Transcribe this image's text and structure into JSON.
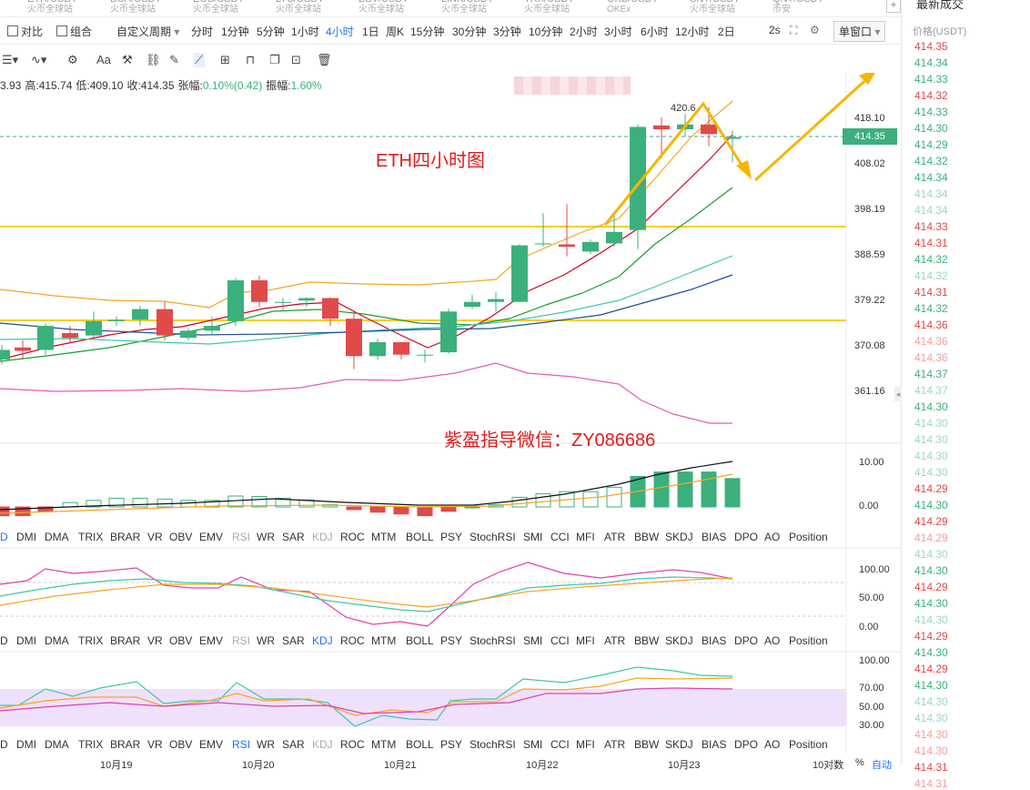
{
  "pairs": [
    {
      "name": "ETH/USDT",
      "ex": "火币全球站"
    },
    {
      "name": "BCH/USDT",
      "ex": "火币全球站"
    },
    {
      "name": "EOS/USDT",
      "ex": "火币全球站"
    },
    {
      "name": "LTC/USDT",
      "ex": "火币全球站"
    },
    {
      "name": "BSV/USDT",
      "ex": "火币全球站"
    },
    {
      "name": "LINK/USDT",
      "ex": "火币全球站"
    },
    {
      "name": "TRX/USDT",
      "ex": "火币全球站"
    },
    {
      "name": "OKB/USDT",
      "ex": "OKEx"
    },
    {
      "name": "SNT/USDT",
      "ex": "火币全球站"
    },
    {
      "name": "QNT/USDT",
      "ex": "币安"
    }
  ],
  "toolbar": {
    "compare": "对比",
    "combine": "组合",
    "custom_period": "自定义周期",
    "periods": [
      "分时",
      "1分钟",
      "5分钟",
      "1小时",
      "4小时",
      "1日",
      "周K",
      "15分钟",
      "30分钟",
      "3分钟",
      "10分钟",
      "2小时",
      "3小时",
      "6小时",
      "12小时",
      "2日"
    ],
    "active_period": "4小时",
    "refresh": "2s",
    "window_mode": "单窗口"
  },
  "ohlc": {
    "open": "3.93",
    "high_label": "高:",
    "high": "415.74",
    "low_label": "低:",
    "low": "409.10",
    "close_label": "收:",
    "close": "414.35",
    "chg_label": "张幅:",
    "chg": "0.10%(0.42)",
    "amp_label": "振幅:",
    "amp": "1.60%"
  },
  "annotations": {
    "chart_title": "ETH四小时图",
    "wechat": "紫盈指导微信：ZY086686",
    "peak_label": "420.6"
  },
  "price_axis": [
    "418.10",
    "408.02",
    "398.19",
    "388.59",
    "379.22",
    "370.08",
    "361.16"
  ],
  "current_price": "414.35",
  "macd_axis": [
    "10.00",
    "0.00"
  ],
  "osc1_axis": [
    "100.00",
    "50.00",
    "0.00"
  ],
  "osc2_axis": [
    "100.00",
    "70.00",
    "50.00",
    "30.00"
  ],
  "indicator_tabs": [
    "D",
    "DMI",
    "DMA",
    "TRIX",
    "BRAR",
    "VR",
    "OBV",
    "EMV",
    "RSI",
    "WR",
    "SAR",
    "KDJ",
    "ROC",
    "MTM",
    "BOLL",
    "PSY",
    "StochRSI",
    "SMI",
    "CCI",
    "MFI",
    "ATR",
    "BBW",
    "SKDJ",
    "BIAS",
    "DPO",
    "AO",
    "Position"
  ],
  "tab_selected": [
    "",
    "KDJ",
    "RSI"
  ],
  "dates": [
    "10月19",
    "10月20",
    "10月21",
    "10月22",
    "10月23"
  ],
  "bottom_right": {
    "pct": "%",
    "auto": "自动",
    "log": "10对数"
  },
  "right_panel": {
    "title": "最新成交",
    "header": "价格(USDT)",
    "trades": [
      {
        "p": "414.35",
        "c": "dn"
      },
      {
        "p": "414.34",
        "c": "up"
      },
      {
        "p": "414.33",
        "c": "up"
      },
      {
        "p": "414.32",
        "c": "dn"
      },
      {
        "p": "414.33",
        "c": "up"
      },
      {
        "p": "414.30",
        "c": "up"
      },
      {
        "p": "414.29",
        "c": "up"
      },
      {
        "p": "414.32",
        "c": "up"
      },
      {
        "p": "414.34",
        "c": "up"
      },
      {
        "p": "414.34",
        "c": "upl"
      },
      {
        "p": "414.34",
        "c": "upl"
      },
      {
        "p": "414.33",
        "c": "dn"
      },
      {
        "p": "414.31",
        "c": "dn"
      },
      {
        "p": "414.32",
        "c": "up"
      },
      {
        "p": "414.32",
        "c": "upl"
      },
      {
        "p": "414.31",
        "c": "dn"
      },
      {
        "p": "414.32",
        "c": "up"
      },
      {
        "p": "414.36",
        "c": "dn"
      },
      {
        "p": "414.36",
        "c": "dnl"
      },
      {
        "p": "414.36",
        "c": "dnl"
      },
      {
        "p": "414.37",
        "c": "up"
      },
      {
        "p": "414.37",
        "c": "upl"
      },
      {
        "p": "414.30",
        "c": "up"
      },
      {
        "p": "414.30",
        "c": "upl"
      },
      {
        "p": "414.30",
        "c": "upl"
      },
      {
        "p": "414.30",
        "c": "upl"
      },
      {
        "p": "414.30",
        "c": "upl"
      },
      {
        "p": "414.29",
        "c": "dn"
      },
      {
        "p": "414.30",
        "c": "up"
      },
      {
        "p": "414.29",
        "c": "dn"
      },
      {
        "p": "414.29",
        "c": "dnl"
      },
      {
        "p": "414.30",
        "c": "upl"
      },
      {
        "p": "414.30",
        "c": "up"
      },
      {
        "p": "414.29",
        "c": "dn"
      },
      {
        "p": "414.30",
        "c": "up"
      },
      {
        "p": "414.30",
        "c": "upl"
      },
      {
        "p": "414.29",
        "c": "dn"
      },
      {
        "p": "414.30",
        "c": "up"
      },
      {
        "p": "414.29",
        "c": "dn"
      },
      {
        "p": "414.30",
        "c": "up"
      },
      {
        "p": "414.30",
        "c": "upl"
      },
      {
        "p": "414.30",
        "c": "upl"
      },
      {
        "p": "414.30",
        "c": "dnl"
      },
      {
        "p": "414.30",
        "c": "dnl"
      },
      {
        "p": "414.31",
        "c": "dn"
      },
      {
        "p": "414.31",
        "c": "dnl"
      }
    ]
  },
  "colors": {
    "up": "#3bb07c",
    "down": "#e04a4a",
    "accent": "#1e6fff",
    "annotation": "#f7b500",
    "support_line": "#f5d000"
  }
}
